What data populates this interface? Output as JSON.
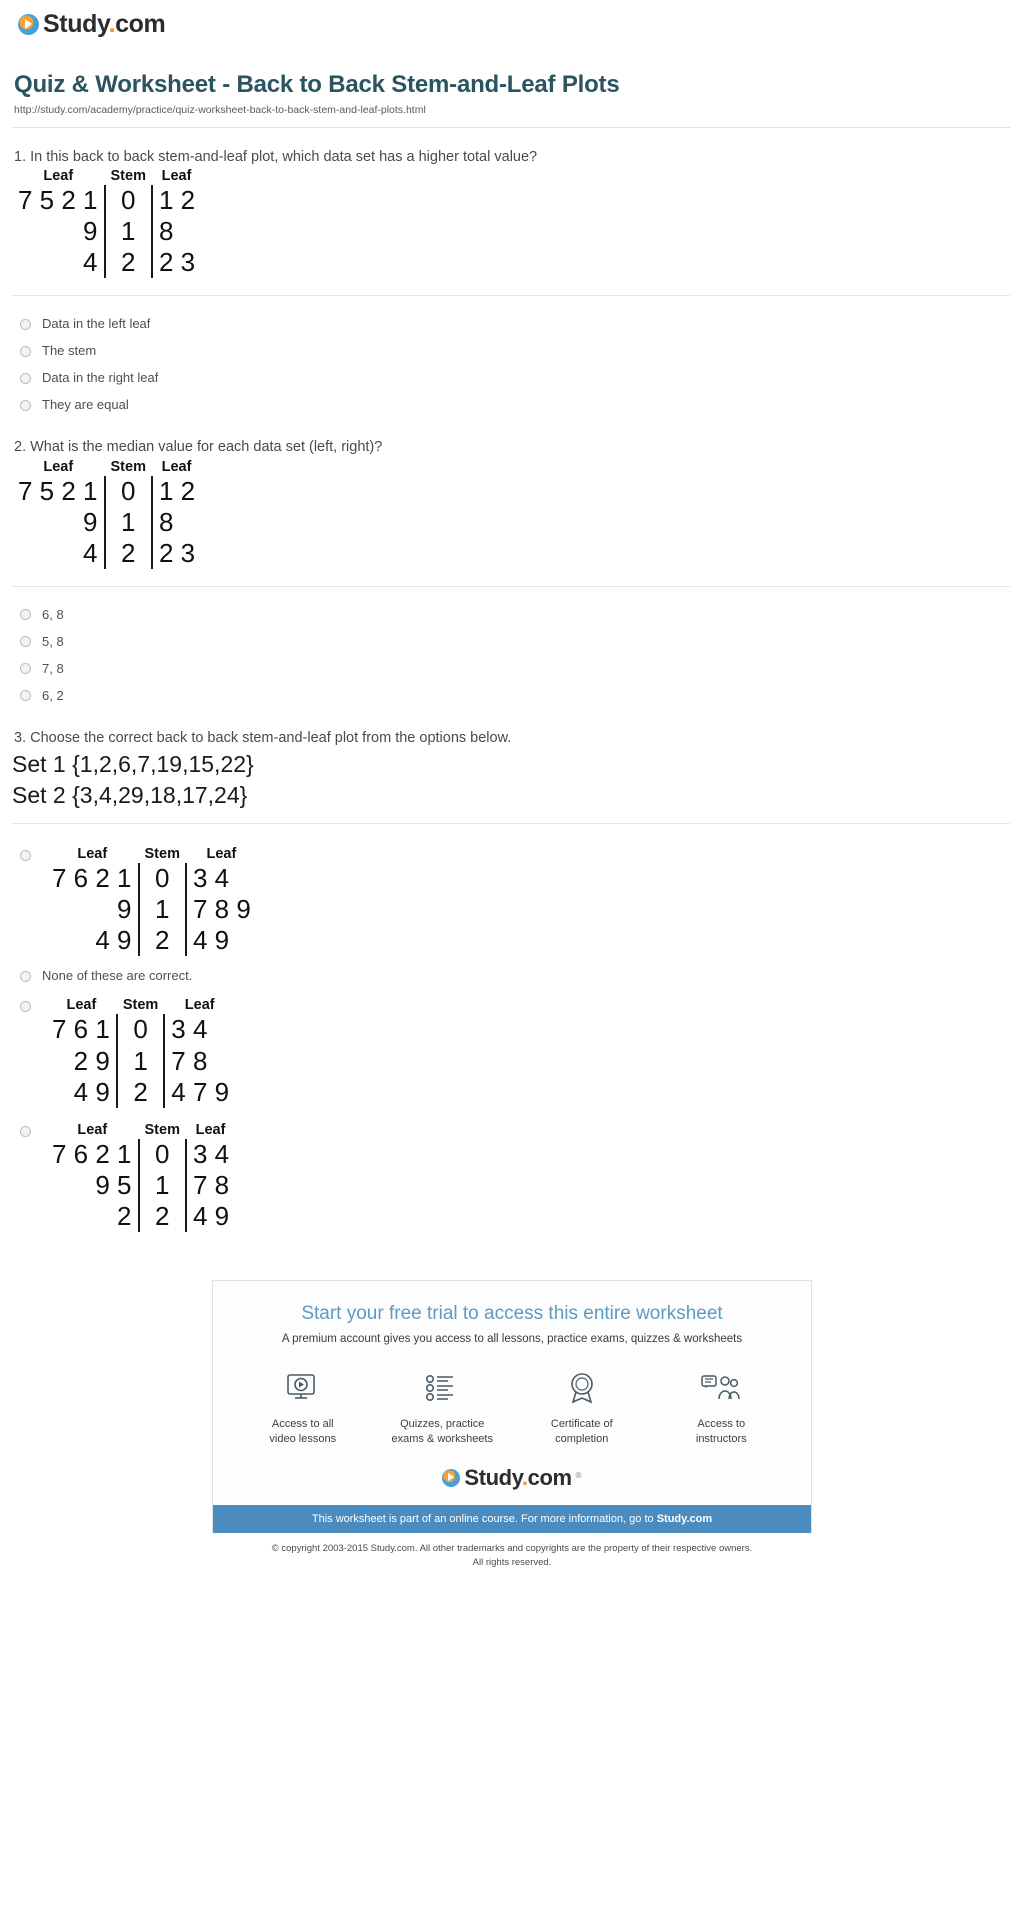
{
  "brand": {
    "name": "Study",
    "suffix": ".com",
    "dot": "."
  },
  "header": {
    "title": "Quiz & Worksheet - Back to Back Stem-and-Leaf Plots",
    "url": "http://study.com/academy/practice/quiz-worksheet-back-to-back-stem-and-leaf-plots.html"
  },
  "plot_headers": {
    "leaf_left": "Leaf",
    "stem": "Stem",
    "leaf_right": "Leaf"
  },
  "questions": [
    {
      "text": "1. In this back to back stem-and-leaf plot, which data set has a higher total value?",
      "plot": {
        "rows": [
          {
            "leaf_left": "7 5 2 1",
            "stem": "0",
            "leaf_right": "1 2"
          },
          {
            "leaf_left": "9",
            "stem": "1",
            "leaf_right": "8"
          },
          {
            "leaf_left": "4",
            "stem": "2",
            "leaf_right": "2 3"
          }
        ]
      },
      "options": [
        {
          "label": "Data in the left leaf"
        },
        {
          "label": "The stem"
        },
        {
          "label": "Data in the right leaf"
        },
        {
          "label": "They are equal"
        }
      ]
    },
    {
      "text": "2. What is the median value for each data set (left, right)?",
      "plot": {
        "rows": [
          {
            "leaf_left": "7 5 2 1",
            "stem": "0",
            "leaf_right": "1 2"
          },
          {
            "leaf_left": "9",
            "stem": "1",
            "leaf_right": "8"
          },
          {
            "leaf_left": "4",
            "stem": "2",
            "leaf_right": "2 3"
          }
        ]
      },
      "options": [
        {
          "label": "6, 8"
        },
        {
          "label": "5, 8"
        },
        {
          "label": "7, 8"
        },
        {
          "label": "6, 2"
        }
      ]
    },
    {
      "text": "3. Choose the correct back to back stem-and-leaf plot from the options below.",
      "sets": [
        "Set 1 {1,2,6,7,19,15,22}",
        "Set 2 {3,4,29,18,17,24}"
      ],
      "plot_options": [
        {
          "type": "plot",
          "rows": [
            {
              "leaf_left": "7 6 2 1",
              "stem": "0",
              "leaf_right": "3 4"
            },
            {
              "leaf_left": "9",
              "stem": "1",
              "leaf_right": "7 8 9"
            },
            {
              "leaf_left": "4 9",
              "stem": "2",
              "leaf_right": "4 9"
            }
          ]
        },
        {
          "type": "text",
          "label": "None of these are correct."
        },
        {
          "type": "plot",
          "rows": [
            {
              "leaf_left": "7 6 1",
              "stem": "0",
              "leaf_right": "3 4"
            },
            {
              "leaf_left": "2 9",
              "stem": "1",
              "leaf_right": "7 8"
            },
            {
              "leaf_left": "4 9",
              "stem": "2",
              "leaf_right": "4 7 9"
            }
          ]
        },
        {
          "type": "plot",
          "rows": [
            {
              "leaf_left": "7 6 2 1",
              "stem": "0",
              "leaf_right": "3 4"
            },
            {
              "leaf_left": "9 5",
              "stem": "1",
              "leaf_right": "7 8"
            },
            {
              "leaf_left": "2",
              "stem": "2",
              "leaf_right": "4 9"
            }
          ]
        }
      ]
    }
  ],
  "promo": {
    "title": "Start your free trial to access this entire worksheet",
    "subtitle": "A premium account gives you access to all lessons, practice exams, quizzes & worksheets",
    "features": [
      {
        "icon": "video-lessons-icon",
        "label": "Access to all\nvideo lessons"
      },
      {
        "icon": "quiz-list-icon",
        "label": "Quizzes, practice\nexams & worksheets"
      },
      {
        "icon": "certificate-icon",
        "label": "Certificate of\ncompletion"
      },
      {
        "icon": "instructors-icon",
        "label": "Access to\ninstructors"
      }
    ],
    "bar_text": "This worksheet is part of an online course. For more information, go to ",
    "bar_link": "Study.com",
    "trademark": "®"
  },
  "copyright": {
    "line1": "© copyright 2003-2015 Study.com. All other trademarks and copyrights are the property of their respective owners.",
    "line2": "All rights reserved."
  }
}
